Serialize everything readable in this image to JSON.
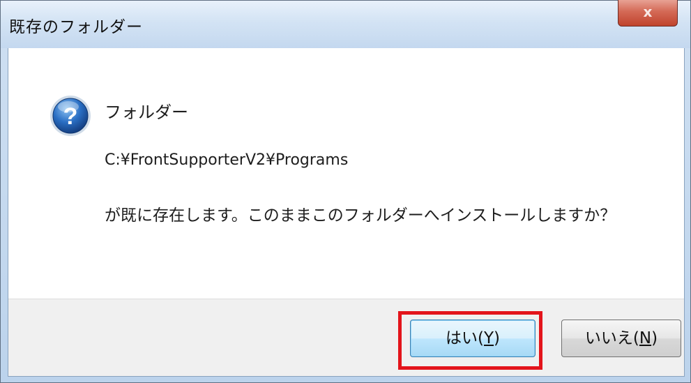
{
  "window": {
    "title": "既存のフォルダー",
    "close_label": "x"
  },
  "message": {
    "icon": "question-icon",
    "heading": "フォルダー",
    "path": "C:¥FrontSupporterV2¥Programs",
    "body": "が既に存在します。このままこのフォルダーへインストールしますか？"
  },
  "buttons": {
    "yes": {
      "text": "はい(",
      "mnemonic": "Y",
      "suffix": ")"
    },
    "no": {
      "text": "いいえ(",
      "mnemonic": "N",
      "suffix": ")"
    }
  },
  "colors": {
    "highlight": "#e3141b",
    "default_button": "#bee6fd",
    "icon_blue": "#1f5fb0"
  }
}
